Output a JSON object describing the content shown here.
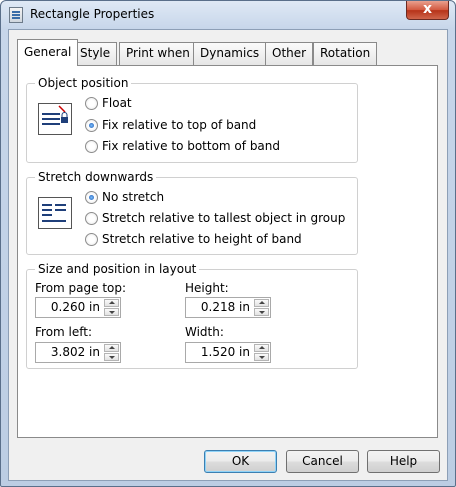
{
  "window": {
    "title": "Rectangle Properties",
    "close_label": "x"
  },
  "tabs": [
    {
      "label": "General",
      "active": true
    },
    {
      "label": "Style"
    },
    {
      "label": "Print when"
    },
    {
      "label": "Dynamics"
    },
    {
      "label": "Other"
    },
    {
      "label": "Rotation"
    }
  ],
  "object_position": {
    "title": "Object position",
    "icon": "position-icon",
    "options": [
      {
        "label": "Float",
        "checked": false
      },
      {
        "label": "Fix relative to top of band",
        "checked": true
      },
      {
        "label": "Fix relative to bottom of band",
        "checked": false
      }
    ]
  },
  "stretch": {
    "title": "Stretch downwards",
    "icon": "stretch-icon",
    "options": [
      {
        "label": "No stretch",
        "checked": true
      },
      {
        "label": "Stretch relative to tallest object in group",
        "checked": false
      },
      {
        "label": "Stretch relative to height of band",
        "checked": false
      }
    ]
  },
  "size_position": {
    "title": "Size and position in layout",
    "from_page_top": {
      "label": "From page top:",
      "value": "0.260 in"
    },
    "height": {
      "label": "Height:",
      "value": "0.218 in"
    },
    "from_left": {
      "label": "From left:",
      "value": "3.802 in"
    },
    "width": {
      "label": "Width:",
      "value": "1.520 in"
    }
  },
  "buttons": {
    "ok": "OK",
    "cancel": "Cancel",
    "help": "Help"
  }
}
